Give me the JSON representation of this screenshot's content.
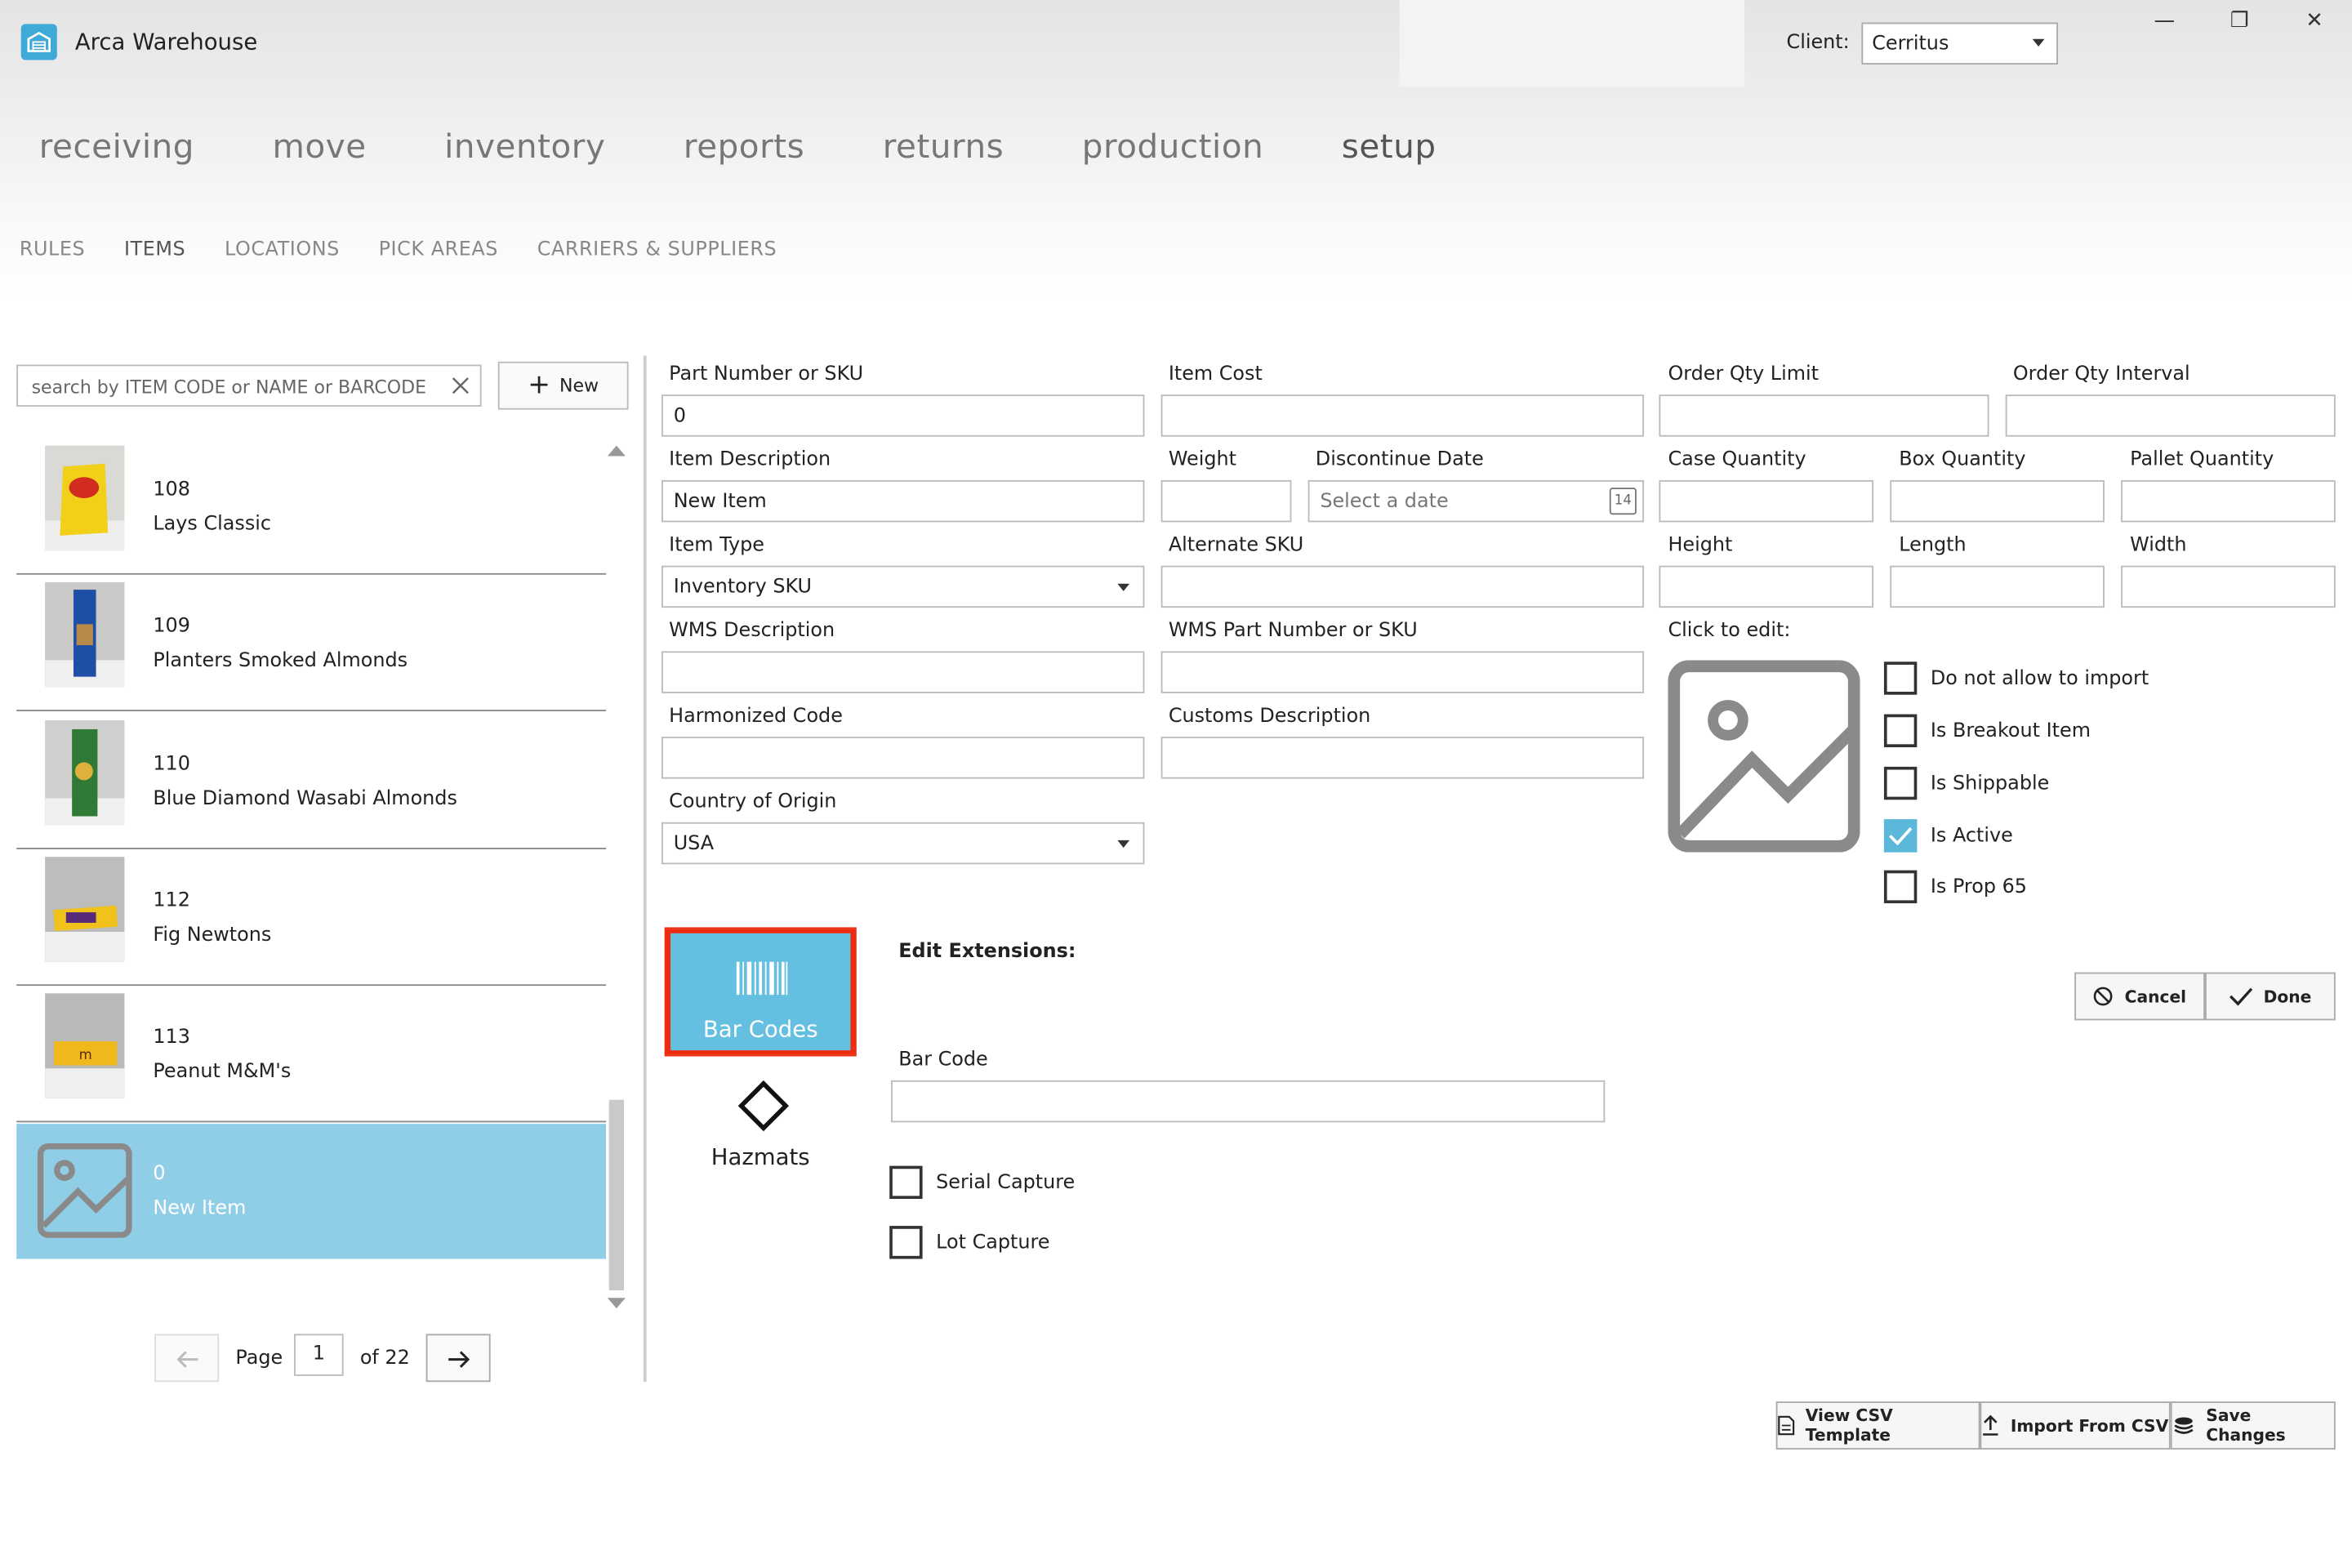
{
  "app": {
    "title": "Arca Warehouse"
  },
  "client": {
    "label": "Client:",
    "value": "Cerritus"
  },
  "window_controls": {
    "minimize": "—",
    "restore": "❐",
    "close": "✕"
  },
  "main_nav": [
    {
      "label": "receiving"
    },
    {
      "label": "move"
    },
    {
      "label": "inventory"
    },
    {
      "label": "reports"
    },
    {
      "label": "returns"
    },
    {
      "label": "production"
    },
    {
      "label": "setup"
    }
  ],
  "sub_nav": [
    {
      "label": "RULES"
    },
    {
      "label": "ITEMS"
    },
    {
      "label": "LOCATIONS"
    },
    {
      "label": "PICK AREAS"
    },
    {
      "label": "CARRIERS & SUPPLIERS"
    }
  ],
  "search": {
    "placeholder": "search by ITEM CODE or NAME or BARCODE"
  },
  "new_button": {
    "label": "New"
  },
  "items": [
    {
      "code": "108",
      "name": "Lays Classic"
    },
    {
      "code": "109",
      "name": "Planters Smoked Almonds"
    },
    {
      "code": "110",
      "name": "Blue Diamond Wasabi Almonds"
    },
    {
      "code": "112",
      "name": "Fig Newtons"
    },
    {
      "code": "113",
      "name": "Peanut M&M's"
    },
    {
      "code": "0",
      "name": "New Item"
    }
  ],
  "pager": {
    "page_label": "Page",
    "page": "1",
    "of_label": "of 22"
  },
  "form": {
    "part_number": {
      "label": "Part Number or SKU",
      "value": "0"
    },
    "item_cost": {
      "label": "Item Cost",
      "value": ""
    },
    "order_qty_limit": {
      "label": "Order Qty Limit",
      "value": ""
    },
    "order_qty_interval": {
      "label": "Order Qty Interval",
      "value": ""
    },
    "item_description": {
      "label": "Item Description",
      "value": "New Item"
    },
    "weight": {
      "label": "Weight",
      "value": ""
    },
    "discontinue_date": {
      "label": "Discontinue Date",
      "placeholder": "Select a date",
      "calendar_day": "14"
    },
    "case_quantity": {
      "label": "Case Quantity",
      "value": ""
    },
    "box_quantity": {
      "label": "Box Quantity",
      "value": ""
    },
    "pallet_quantity": {
      "label": "Pallet Quantity",
      "value": ""
    },
    "item_type": {
      "label": "Item Type",
      "value": "Inventory SKU"
    },
    "alternate_sku": {
      "label": "Alternate SKU",
      "value": ""
    },
    "height": {
      "label": "Height",
      "value": ""
    },
    "length": {
      "label": "Length",
      "value": ""
    },
    "width": {
      "label": "Width",
      "value": ""
    },
    "wms_description": {
      "label": "WMS Description",
      "value": ""
    },
    "wms_part_number": {
      "label": "WMS Part Number or SKU",
      "value": ""
    },
    "click_to_edit": "Click to edit:",
    "harmonized_code": {
      "label": "Harmonized Code",
      "value": ""
    },
    "customs_description": {
      "label": "Customs Description",
      "value": ""
    },
    "country_of_origin": {
      "label": "Country of Origin",
      "value": "USA"
    }
  },
  "flags": [
    {
      "label": "Do not allow to import",
      "checked": false
    },
    {
      "label": "Is Breakout Item",
      "checked": false
    },
    {
      "label": "Is Shippable",
      "checked": false
    },
    {
      "label": "Is Active",
      "checked": true
    },
    {
      "label": "Is Prop 65",
      "checked": false
    }
  ],
  "extensions": {
    "title": "Edit Extensions:",
    "bar_codes_label": "Bar Codes",
    "hazmats_label": "Hazmats",
    "bar_code_field": {
      "label": "Bar Code",
      "value": ""
    },
    "serial_capture": {
      "label": "Serial Capture",
      "checked": false
    },
    "lot_capture": {
      "label": "Lot Capture",
      "checked": false
    }
  },
  "actions": {
    "cancel": "Cancel",
    "done": "Done",
    "view_csv_template": "View CSV Template",
    "import_from_csv": "Import From CSV",
    "save_changes": "Save Changes"
  },
  "colors": {
    "accent": "#64bfe0",
    "selected_row": "#90cde6",
    "highlight_border": "#ee2b0f",
    "checked": "#5bb8db"
  }
}
